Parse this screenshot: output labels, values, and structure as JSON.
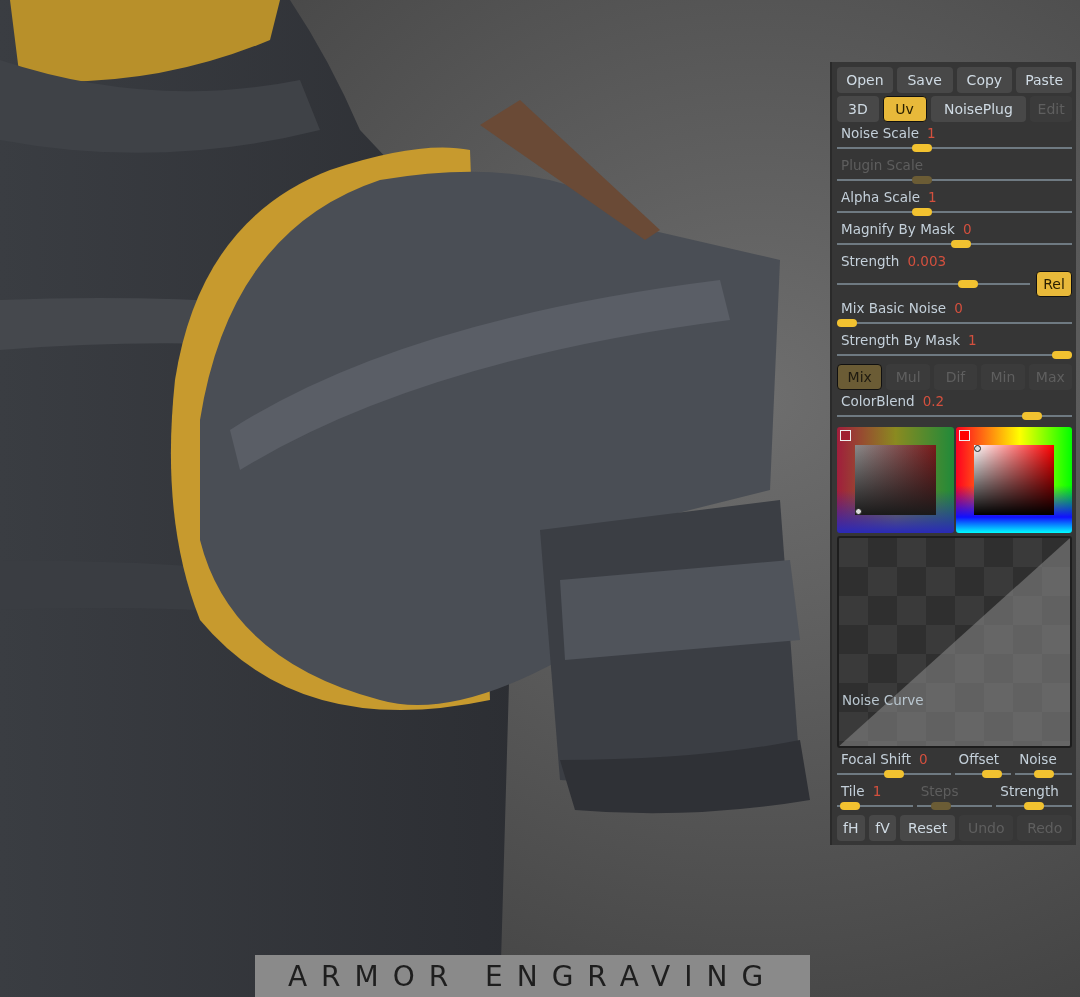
{
  "file_buttons": [
    {
      "label": "Open"
    },
    {
      "label": "Save"
    },
    {
      "label": "Copy"
    },
    {
      "label": "Paste"
    }
  ],
  "mode_buttons": [
    {
      "label": "3D",
      "selected": false,
      "disabled": false
    },
    {
      "label": "Uv",
      "selected": true,
      "disabled": false
    },
    {
      "label": "NoisePlug",
      "selected": false,
      "disabled": false
    },
    {
      "label": "Edit",
      "selected": false,
      "disabled": true
    }
  ],
  "sliders": [
    {
      "label": "Noise Scale",
      "value": "1",
      "level": 0.35,
      "disabled": false
    },
    {
      "label": "Plugin Scale",
      "level": 0.35,
      "disabled": true
    },
    {
      "label": "Alpha Scale",
      "value": "1",
      "level": 0.35,
      "disabled": false
    },
    {
      "label": "Magnify By Mask",
      "value": "0",
      "level": 0.53,
      "disabled": false
    },
    {
      "label": "Strength",
      "value": "0.003",
      "level": 0.7,
      "disabled": false,
      "toggle": {
        "label": "Rel",
        "selected": true
      }
    },
    {
      "label": "Mix Basic Noise",
      "value": "0",
      "level": 0,
      "disabled": false
    },
    {
      "label": "Strength By Mask",
      "value": "1",
      "level": 1,
      "disabled": false
    }
  ],
  "blend_modes": [
    {
      "label": "Mix",
      "selected": true
    },
    {
      "label": "Mul",
      "selected": false
    },
    {
      "label": "Dif",
      "selected": false
    },
    {
      "label": "Min",
      "selected": false
    },
    {
      "label": "Max",
      "selected": false
    }
  ],
  "color_blend": {
    "label": "ColorBlend",
    "value": "0.2",
    "level": 0.86,
    "disabled": false
  },
  "noise_curve": {
    "label": "Noise Curve"
  },
  "curve_sliders": [
    [
      {
        "label": "Focal Shift",
        "value": "0",
        "level": 0.5,
        "disabled": false
      },
      {
        "label": "Offset",
        "level": 0.75,
        "disabled": false
      },
      {
        "label": "Noise",
        "level": 0.5,
        "disabled": false
      }
    ],
    [
      {
        "label": "Tile",
        "value": "1",
        "level": 0.05,
        "disabled": false
      },
      {
        "label": "Steps",
        "level": 0.25,
        "disabled": true
      },
      {
        "label": "Strength",
        "level": 0.5,
        "disabled": false
      }
    ]
  ],
  "curve_buttons": [
    {
      "label": "fH",
      "disabled": false
    },
    {
      "label": "fV",
      "disabled": false
    },
    {
      "label": "Reset",
      "disabled": false
    },
    {
      "label": "Undo",
      "disabled": true
    },
    {
      "label": "Redo",
      "disabled": true
    }
  ],
  "caption": "ARMOR ENGRAVING"
}
